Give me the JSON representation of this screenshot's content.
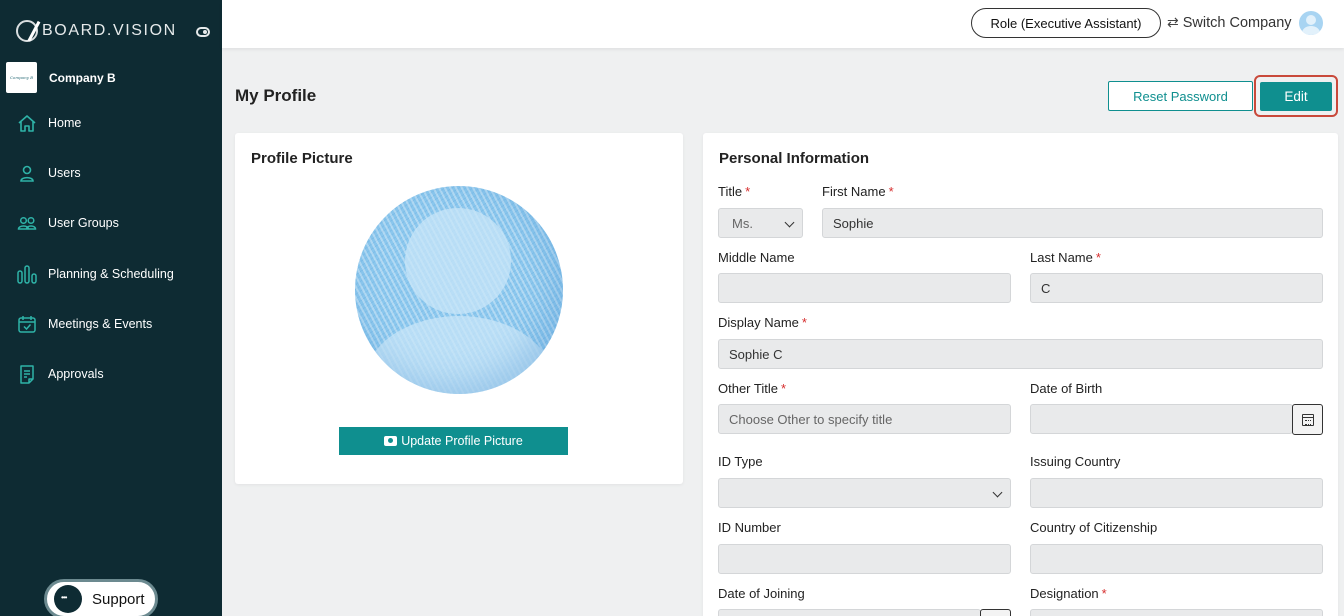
{
  "sidebar": {
    "brand": "BOARD.VISION",
    "company_logo_text": "Company B",
    "company_name": "Company B",
    "items": [
      {
        "label": "Home",
        "icon": "home-icon"
      },
      {
        "label": "Users",
        "icon": "user-icon"
      },
      {
        "label": "User Groups",
        "icon": "user-groups-icon"
      },
      {
        "label": "Planning & Scheduling",
        "icon": "bar-chart-icon"
      },
      {
        "label": "Meetings & Events",
        "icon": "calendar-check-icon"
      },
      {
        "label": "Approvals",
        "icon": "document-icon"
      }
    ],
    "support_label": "Support"
  },
  "topbar": {
    "role": "Role (Executive Assistant)",
    "switch_company": "Switch Company"
  },
  "main": {
    "title": "My Profile",
    "reset_password": "Reset Password",
    "edit": "Edit"
  },
  "profile_picture": {
    "title": "Profile Picture",
    "update_button": "Update Profile Picture"
  },
  "personal": {
    "title": "Personal Information",
    "fields": {
      "title": {
        "label": "Title",
        "value": "Ms."
      },
      "first_name": {
        "label": "First Name",
        "value": "Sophie"
      },
      "middle_name": {
        "label": "Middle Name",
        "value": ""
      },
      "last_name": {
        "label": "Last Name",
        "value": "C"
      },
      "display_name": {
        "label": "Display Name",
        "value": "Sophie C"
      },
      "other_title": {
        "label": "Other Title",
        "placeholder": "Choose Other to specify title"
      },
      "date_of_birth": {
        "label": "Date of Birth",
        "value": ""
      },
      "id_type": {
        "label": "ID Type",
        "value": ""
      },
      "issuing_country": {
        "label": "Issuing Country",
        "value": ""
      },
      "id_number": {
        "label": "ID Number",
        "value": ""
      },
      "country_of_citizenship": {
        "label": "Country of Citizenship",
        "value": ""
      },
      "date_of_joining": {
        "label": "Date of Joining",
        "value": ""
      },
      "designation": {
        "label": "Designation",
        "value": ""
      }
    },
    "required_mark": "*"
  },
  "colors": {
    "sidebar_bg": "#0e2b33",
    "accent": "#0f8f8f",
    "highlight": "#c9493b",
    "required": "#d62d2d"
  }
}
